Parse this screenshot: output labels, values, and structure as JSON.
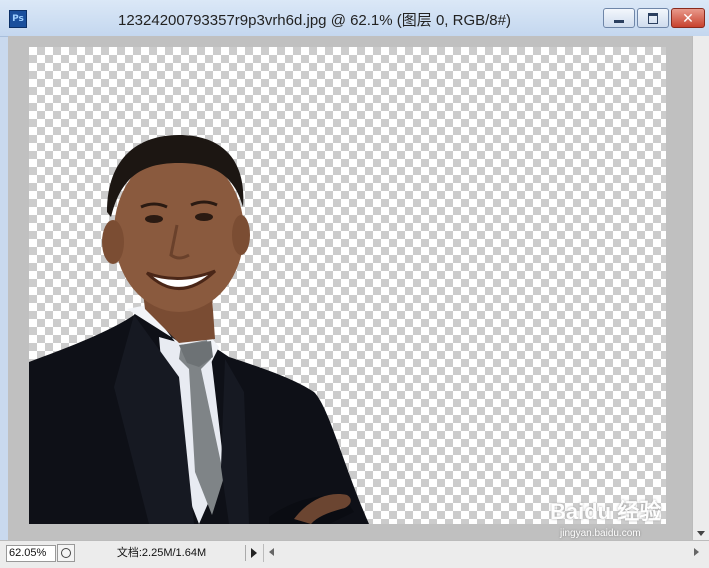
{
  "window": {
    "title": "12324200793357r9p3vrh6d.jpg @ 62.1% (图层 0, RGB/8#)",
    "app_icon_text": "Ps",
    "close_glyph": "✕"
  },
  "statusbar": {
    "zoom_value": "62.05%",
    "doc_info": "文档:2.25M/1.64M"
  },
  "watermark": {
    "text": "Baidu 经验",
    "subtext": "jingyan.baidu.com"
  },
  "colors": {
    "transparency_check": "#cccccc",
    "suit": "#0e1017",
    "shirt": "#f2f4f8",
    "tie": "#7f8487",
    "skin": "#8a5a3e",
    "hair": "#1c1612",
    "window_frame": "#c9d9ee",
    "close_button": "#c8422e"
  },
  "icons": [
    "photoshop-app-icon",
    "minimize-icon",
    "maximize-icon",
    "close-icon",
    "status-options-icon",
    "arrow-right-icon",
    "scroll-left-icon",
    "scroll-right-icon",
    "scroll-down-icon"
  ]
}
